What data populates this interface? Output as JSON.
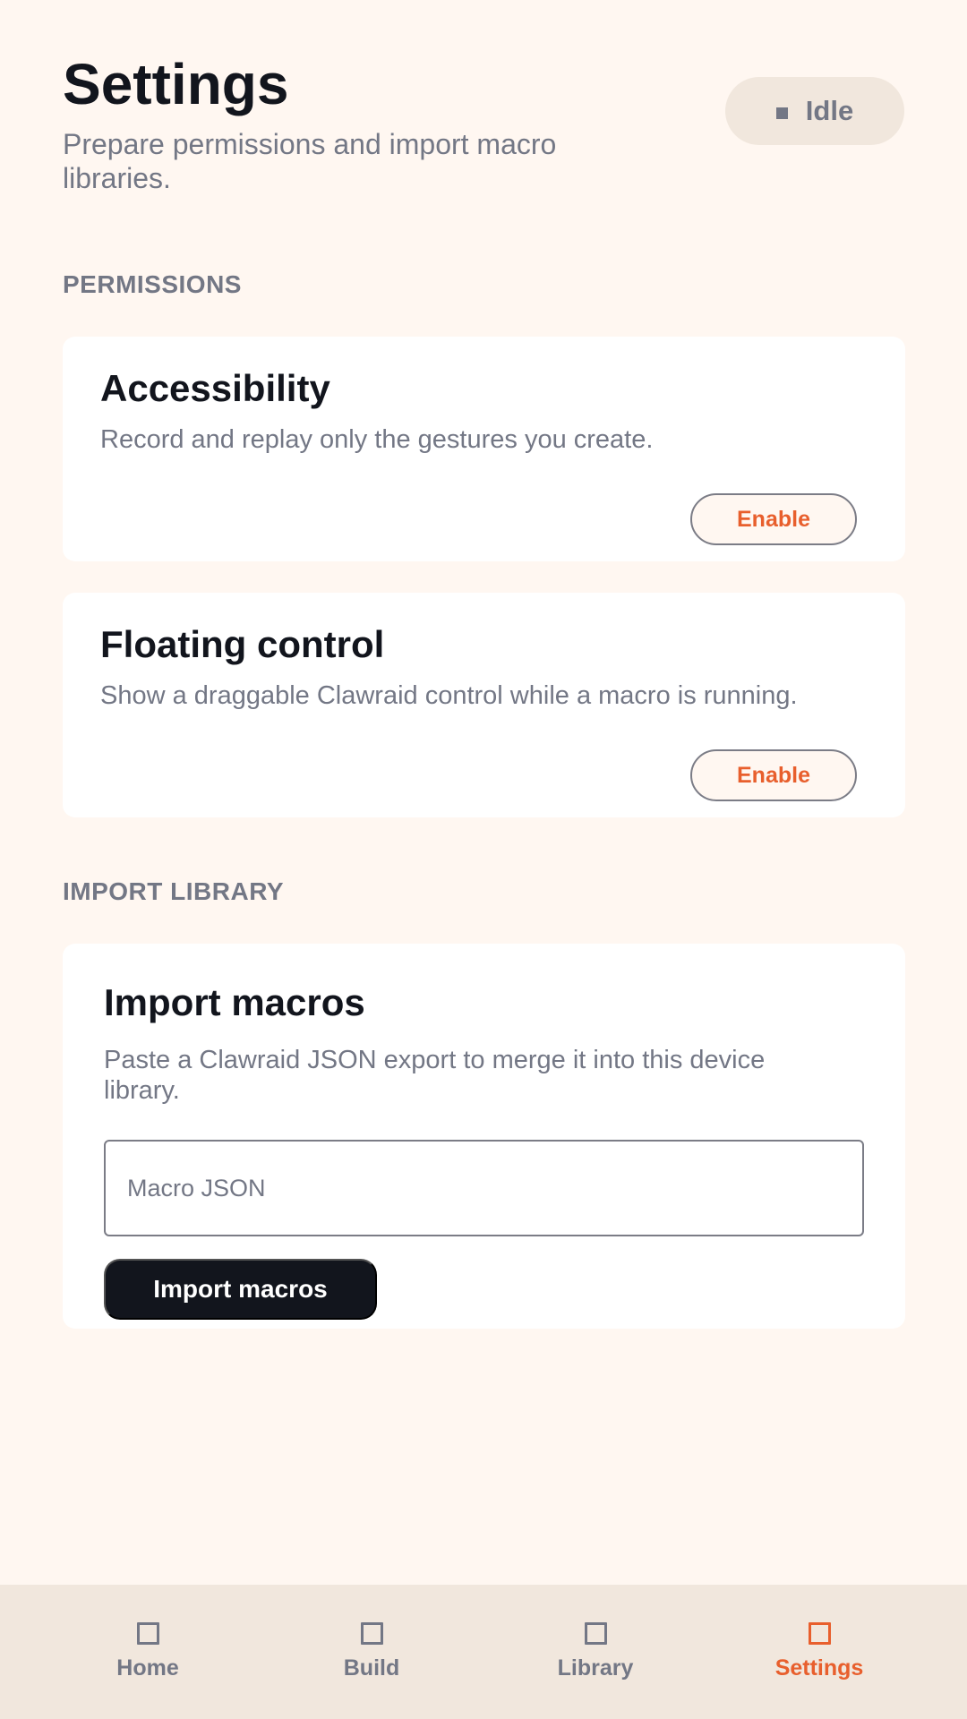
{
  "header": {
    "title": "Settings",
    "subtitle": "Prepare permissions and import macro libraries.",
    "status": {
      "icon": "stop-square-icon",
      "label": "Idle"
    }
  },
  "permissions": {
    "section_label": "PERMISSIONS",
    "items": [
      {
        "title": "Accessibility",
        "description": "Record and replay only the gestures you create.",
        "button": "Enable"
      },
      {
        "title": "Floating control",
        "description": "Show a draggable Clawraid control while a macro is running.",
        "button": "Enable"
      }
    ]
  },
  "import_library": {
    "section_label": "IMPORT LIBRARY",
    "card_title": "Import macros",
    "description": "Paste a Clawraid JSON export to merge it into this device library.",
    "input": {
      "value": "",
      "placeholder": "Macro JSON"
    },
    "button": "Import macros"
  },
  "bottom_nav": {
    "items": [
      {
        "label": "Home",
        "icon": "square-icon",
        "active": false
      },
      {
        "label": "Build",
        "icon": "square-icon",
        "active": false
      },
      {
        "label": "Library",
        "icon": "square-icon",
        "active": false
      },
      {
        "label": "Settings",
        "icon": "square-icon",
        "active": true
      }
    ]
  },
  "colors": {
    "background": "#fff7f1",
    "surface": "#ffffff",
    "muted_surface": "#f1e7dd",
    "text": "#12151d",
    "muted_text": "#737785",
    "accent": "#e85f2d",
    "border": "#7b7c86"
  }
}
